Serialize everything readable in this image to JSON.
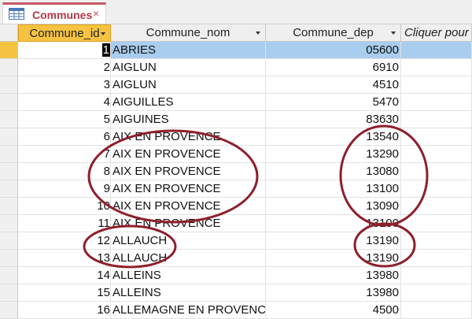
{
  "tab": {
    "title": "Communes",
    "close_glyph": "×",
    "icon": "table-icon"
  },
  "columns": [
    {
      "label": "Commune_id"
    },
    {
      "label": "Commune_nom"
    },
    {
      "label": "Commune_dep"
    },
    {
      "label": "Cliquer pour"
    }
  ],
  "rows": [
    {
      "id": "1",
      "nom": "ABRIES",
      "dep": "05600"
    },
    {
      "id": "2",
      "nom": "AIGLUN",
      "dep": "6910"
    },
    {
      "id": "3",
      "nom": "AIGLUN",
      "dep": "4510"
    },
    {
      "id": "4",
      "nom": "AIGUILLES",
      "dep": "5470"
    },
    {
      "id": "5",
      "nom": "AIGUINES",
      "dep": "83630"
    },
    {
      "id": "6",
      "nom": "AIX EN PROVENCE",
      "dep": "13540"
    },
    {
      "id": "7",
      "nom": "AIX EN PROVENCE",
      "dep": "13290"
    },
    {
      "id": "8",
      "nom": "AIX EN PROVENCE",
      "dep": "13080"
    },
    {
      "id": "9",
      "nom": "AIX EN PROVENCE",
      "dep": "13100"
    },
    {
      "id": "10",
      "nom": "AIX EN PROVENCE",
      "dep": "13090"
    },
    {
      "id": "11",
      "nom": "AIX EN PROVENCE",
      "dep": "13100"
    },
    {
      "id": "12",
      "nom": "ALLAUCH",
      "dep": "13190"
    },
    {
      "id": "13",
      "nom": "ALLAUCH",
      "dep": "13190"
    },
    {
      "id": "14",
      "nom": "ALLEINS",
      "dep": "13980"
    },
    {
      "id": "15",
      "nom": "ALLEINS",
      "dep": "13980"
    },
    {
      "id": "16",
      "nom": "ALLEMAGNE EN PROVENCE",
      "dep": "4500"
    }
  ],
  "colors": {
    "accent": "#c55a64",
    "selected_header": "#f5c242",
    "selected_row": "#a9cdee",
    "annotation": "#8e1f2c"
  }
}
